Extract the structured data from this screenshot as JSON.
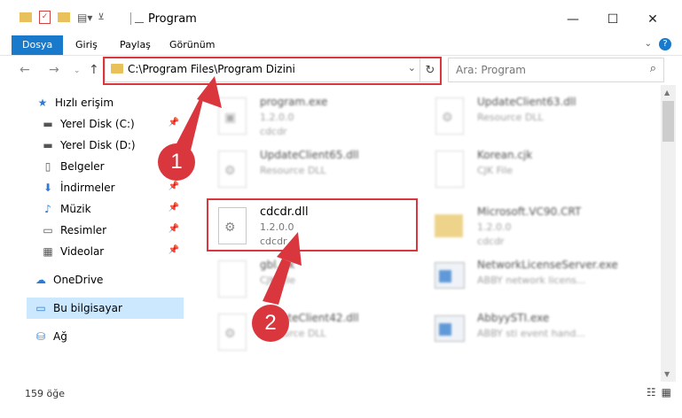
{
  "window": {
    "title": "Program",
    "minimize": "—",
    "maximize": "☐",
    "close": "✕"
  },
  "ribbon": {
    "tabs": [
      "Dosya",
      "Giriş",
      "Paylaş",
      "Görünüm"
    ],
    "help": "?"
  },
  "navigation": {
    "address": "C:\\Program Files\\Program Dizini",
    "search_placeholder": "Ara: Program"
  },
  "sidebar": {
    "items": [
      {
        "label": "Hızlı erişim"
      },
      {
        "label": "Yerel Disk (C:)"
      },
      {
        "label": "Yerel Disk (D:)"
      },
      {
        "label": "Belgeler"
      },
      {
        "label": "İndirmeler"
      },
      {
        "label": "Müzik"
      },
      {
        "label": "Resimler"
      },
      {
        "label": "Videolar"
      },
      {
        "label": "OneDrive"
      },
      {
        "label": "Bu bilgisayar"
      },
      {
        "label": "Ağ"
      }
    ]
  },
  "files": [
    {
      "name": "program.exe",
      "line2": "1.2.0.0",
      "line3": "cdcdr"
    },
    {
      "name": "UpdateClient63.dll",
      "line2": "Resource DLL",
      "line3": ""
    },
    {
      "name": "UpdateClient65.dll",
      "line2": "Resource DLL",
      "line3": ""
    },
    {
      "name": "Korean.cjk",
      "line2": "CJK File",
      "line3": ""
    },
    {
      "name": "cdcdr.dll",
      "line2": "1.2.0.0",
      "line3": "cdcdr"
    },
    {
      "name": "Microsoft.VC90.CRT",
      "line2": "1.2.0.0",
      "line3": "cdcdr"
    },
    {
      "name": "gbl.cjk",
      "line2": "CJK File",
      "line3": ""
    },
    {
      "name": "NetworkLicenseServer.exe",
      "line2": "ABBY network licens...",
      "line3": ""
    },
    {
      "name": "UpdateClient42.dll",
      "line2": "Resource DLL",
      "line3": ""
    },
    {
      "name": "AbbyySTI.exe",
      "line2": "ABBY sti event hand...",
      "line3": ""
    }
  ],
  "status": {
    "count": "159 öğe"
  },
  "annotations": [
    "1",
    "2"
  ]
}
